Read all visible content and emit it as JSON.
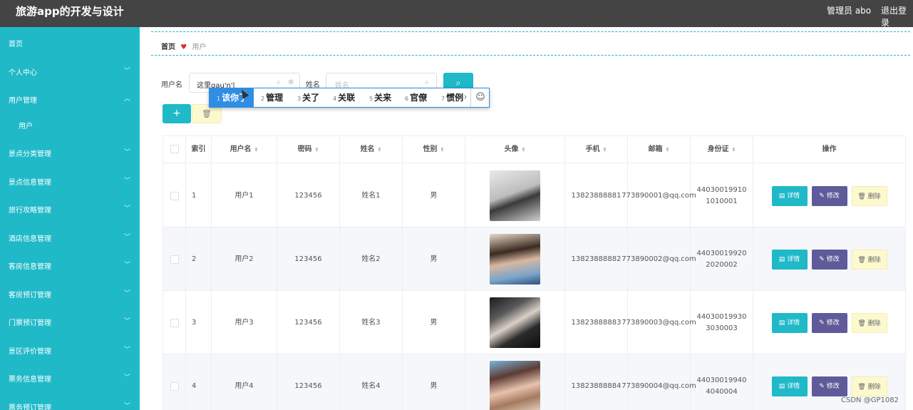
{
  "header": {
    "title": "旅游app的开发与设计",
    "admin": "管理员 abo",
    "logout": "退出登录"
  },
  "sidebar": {
    "items": [
      {
        "label": "首页",
        "chevron": ""
      },
      {
        "label": "个人中心",
        "chevron": "﹀"
      },
      {
        "label": "用户管理",
        "chevron": "︿"
      },
      {
        "label": "用户",
        "chevron": ""
      },
      {
        "label": "景点分类管理",
        "chevron": "﹀"
      },
      {
        "label": "景点信息管理",
        "chevron": "﹀"
      },
      {
        "label": "旅行攻略管理",
        "chevron": "﹀"
      },
      {
        "label": "酒店信息管理",
        "chevron": "﹀"
      },
      {
        "label": "客房信息管理",
        "chevron": "﹀"
      },
      {
        "label": "客房预订管理",
        "chevron": "﹀"
      },
      {
        "label": "门票预订管理",
        "chevron": "﹀"
      },
      {
        "label": "景区评价管理",
        "chevron": "﹀"
      },
      {
        "label": "票务信息管理",
        "chevron": "﹀"
      },
      {
        "label": "票务预订管理",
        "chevron": "﹀"
      }
    ]
  },
  "breadcrumb": {
    "home": "首页",
    "current": "用户"
  },
  "search": {
    "username_label": "用户名",
    "username_value": "这里gau'n'l",
    "name_label": "姓名",
    "name_placeholder": "姓名"
  },
  "ime": {
    "candidates": [
      {
        "num": "1",
        "text": "该你了"
      },
      {
        "num": "2",
        "text": "管理"
      },
      {
        "num": "3",
        "text": "关了"
      },
      {
        "num": "4",
        "text": "关联"
      },
      {
        "num": "5",
        "text": "关来"
      },
      {
        "num": "6",
        "text": "官僚"
      },
      {
        "num": "7",
        "text": "惯例"
      }
    ]
  },
  "table": {
    "headers": {
      "index": "索引",
      "username": "用户名",
      "password": "密码",
      "name": "姓名",
      "gender": "性别",
      "avatar": "头像",
      "phone": "手机",
      "email": "邮箱",
      "idcard": "身份证",
      "actions": "操作"
    },
    "rows": [
      {
        "index": "1",
        "username": "用户1",
        "password": "123456",
        "name": "姓名1",
        "gender": "男",
        "phone": "13823888881",
        "email": "773890001@qq.com",
        "idcard": "440300199101010001"
      },
      {
        "index": "2",
        "username": "用户2",
        "password": "123456",
        "name": "姓名2",
        "gender": "男",
        "phone": "13823888882",
        "email": "773890002@qq.com",
        "idcard": "440300199202020002"
      },
      {
        "index": "3",
        "username": "用户3",
        "password": "123456",
        "name": "姓名3",
        "gender": "男",
        "phone": "13823888883",
        "email": "773890003@qq.com",
        "idcard": "440300199303030003"
      },
      {
        "index": "4",
        "username": "用户4",
        "password": "123456",
        "name": "姓名4",
        "gender": "男",
        "phone": "13823888884",
        "email": "773890004@qq.com",
        "idcard": "440300199404040004"
      }
    ],
    "actions": {
      "detail": "详情",
      "edit": "修改",
      "delete": "删除"
    }
  },
  "watermark": "CSDN @GP1082",
  "colors": {
    "accent": "#1fb9c8",
    "header": "#444444",
    "edit": "#5f5a9a",
    "delete_bg": "#fdf9cf"
  }
}
